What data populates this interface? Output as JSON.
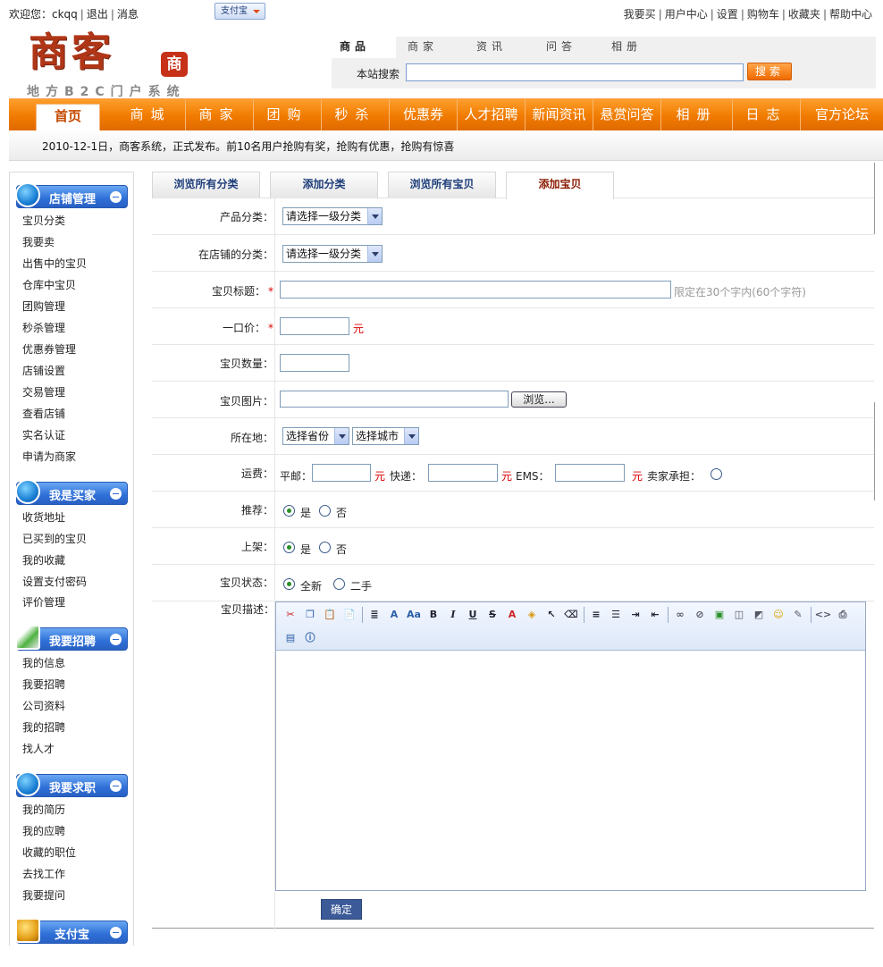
{
  "topbar": {
    "welcome": "欢迎您：ckqq",
    "logout": "退出",
    "messages": "消息",
    "alipay": "支付宝",
    "right_links": [
      "我要买",
      "用户中心",
      "设置",
      "购物车",
      "收藏夹",
      "帮助中心"
    ]
  },
  "logo": {
    "main": "商客",
    "seal": "商",
    "tagline": "地方B2C门户系统"
  },
  "search": {
    "tabs": [
      "商品",
      "商家",
      "资讯",
      "问答",
      "相册"
    ],
    "label": "本站搜索",
    "button": "搜索",
    "value": ""
  },
  "nav": [
    "首页",
    "商城",
    "商家",
    "团购",
    "秒杀",
    "优惠券",
    "人才招聘",
    "新闻资讯",
    "悬赏问答",
    "相册",
    "日志",
    "官方论坛"
  ],
  "announcement": "2010-12-1日，商客系统，正式发布。前10名用户抢购有奖，抢购有优惠，抢购有惊喜",
  "sidebar": {
    "groups": [
      {
        "title": "店铺管理",
        "icon": "user-avatar-icon",
        "items": [
          "宝贝分类",
          "我要卖",
          "出售中的宝贝",
          "仓库中宝贝",
          "团购管理",
          "秒杀管理",
          "优惠券管理",
          "店铺设置",
          "交易管理",
          "查看店铺",
          "实名认证",
          "申请为商家"
        ]
      },
      {
        "title": "我是买家",
        "icon": "user-avatar-icon",
        "items": [
          "收货地址",
          "已买到的宝贝",
          "我的收藏",
          "设置支付密码",
          "评价管理"
        ]
      },
      {
        "title": "我要招聘",
        "icon": "pen-paper-icon",
        "items": [
          "我的信息",
          "我要招聘",
          "公司资料",
          "我的招聘",
          "找人才"
        ]
      },
      {
        "title": "我要求职",
        "icon": "user-avatar-icon",
        "items": [
          "我的简历",
          "我的应聘",
          "收藏的职位",
          "去找工作",
          "我要提问"
        ]
      },
      {
        "title": "支付宝",
        "icon": "treasure-chest-icon",
        "items": []
      }
    ]
  },
  "content_tabs": [
    "浏览所有分类",
    "添加分类",
    "浏览所有宝贝",
    "添加宝贝"
  ],
  "form": {
    "category_label": "产品分类：",
    "category_select": "请选择一级分类",
    "shop_category_label": "在店铺的分类：",
    "shop_category_select": "请选择一级分类",
    "title_label": "宝贝标题：",
    "title_hint": "限定在30个字内(60个字符)",
    "price_label": "一口价：",
    "price_unit": "元",
    "qty_label": "宝贝数量：",
    "image_label": "宝贝图片：",
    "browse": "浏览...",
    "location_label": "所在地：",
    "province_select": "选择省份",
    "city_select": "选择城市",
    "shipping_label": "运费：",
    "ship_normal": "平邮：",
    "ship_express": "快递：",
    "ship_ems": "EMS：",
    "ship_unit": "元",
    "seller_pays": "卖家承担：",
    "recommend_label": "推荐：",
    "shelf_label": "上架：",
    "yes": "是",
    "no": "否",
    "status_label": "宝贝状态：",
    "status_new": "全新",
    "status_used": "二手",
    "desc_label": "宝贝描述：",
    "submit": "确定"
  }
}
